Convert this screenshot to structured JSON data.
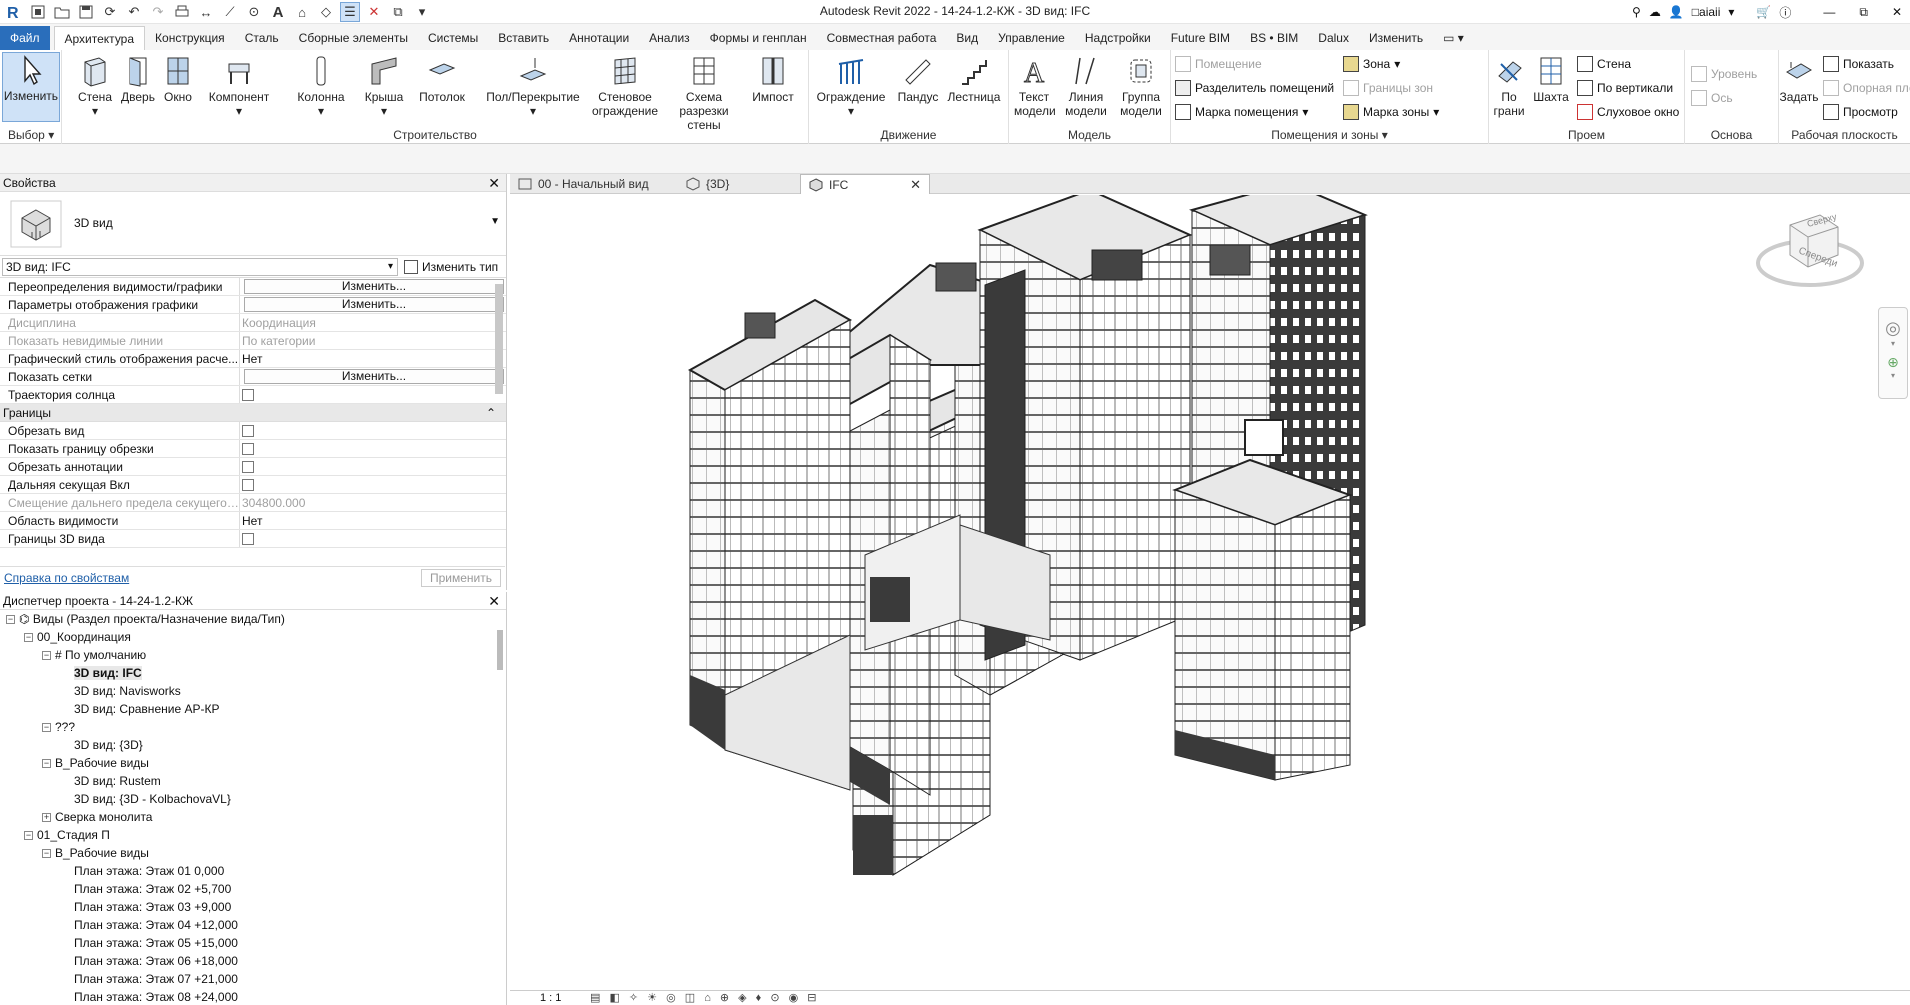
{
  "titlebar": {
    "title": "Autodesk Revit 2022 - 14-24-1.2-КЖ - 3D вид: IFC",
    "user": "□aiaii"
  },
  "ribbon_tabs": [
    "Файл",
    "Архитектура",
    "Конструкция",
    "Сталь",
    "Сборные элементы",
    "Системы",
    "Вставить",
    "Аннотации",
    "Анализ",
    "Формы и генплан",
    "Совместная работа",
    "Вид",
    "Управление",
    "Надстройки",
    "Future BIM",
    "BS • BIM",
    "Dalux",
    "Изменить"
  ],
  "ribbon": {
    "select": {
      "modify": "Изменить",
      "label": "Выбор"
    },
    "build": {
      "wall": "Стена",
      "door": "Дверь",
      "window": "Окно",
      "component": "Компонент",
      "column": "Колонна",
      "roof": "Крыша",
      "ceiling": "Потолок",
      "floor": "Пол/Перекрытие",
      "curtain_system": "Стеновое ограждение",
      "curtain_grid": "Схема разрезки стены",
      "mullion": "Импост",
      "label": "Строительство"
    },
    "circulation": {
      "railing": "Ограждение",
      "ramp": "Пандус",
      "stair": "Лестница",
      "label": "Движение"
    },
    "model": {
      "text": "Текст модели",
      "line": "Линия модели",
      "group": "Группа модели",
      "label": "Модель"
    },
    "rooms": {
      "room": "Помещение",
      "separator": "Разделитель помещений",
      "tag_room": "Марка помещения",
      "area": "Зона",
      "area_boundary": "Границы зон",
      "tag_area": "Марка зоны",
      "label": "Помещения и зоны"
    },
    "opening": {
      "by_face": "По грани",
      "shaft": "Шахта",
      "wall": "Стена",
      "vertical": "По вертикали",
      "dormer": "Слуховое окно",
      "label": "Проем"
    },
    "datum": {
      "level": "Уровень",
      "grid": "Ось",
      "label": "Основа"
    },
    "workplane": {
      "set": "Задать",
      "show": "Показать",
      "ref_plane": "Опорная плоскость",
      "viewer": "Просмотр",
      "label": "Рабочая плоскость"
    }
  },
  "properties": {
    "title": "Свойства",
    "type_name": "3D вид",
    "instance": "3D вид: IFC",
    "edit_type": "Изменить тип",
    "rows_top": [
      {
        "k": "Переопределения видимости/графики",
        "v": "Изменить...",
        "btn": true
      },
      {
        "k": "Параметры отображения графики",
        "v": "Изменить...",
        "btn": true
      },
      {
        "k": "Дисциплина",
        "v": "Координация",
        "dim": true
      },
      {
        "k": "Показать невидимые линии",
        "v": "По категории",
        "dim": true
      },
      {
        "k": "Графический стиль отображения расче...",
        "v": "Нет"
      },
      {
        "k": "Показать сетки",
        "v": "Изменить...",
        "btn": true
      },
      {
        "k": "Траектория солнца",
        "v": "",
        "chk": true
      }
    ],
    "group": "Границы",
    "rows_bottom": [
      {
        "k": "Обрезать вид",
        "v": "",
        "chk": true
      },
      {
        "k": "Показать границу обрезки",
        "v": "",
        "chk": true
      },
      {
        "k": "Обрезать аннотации",
        "v": "",
        "chk": true
      },
      {
        "k": "Дальняя секущая Вкл",
        "v": "",
        "chk": true
      },
      {
        "k": "Смещение дальнего предела секущего ...",
        "v": "304800.000",
        "dim": true
      },
      {
        "k": "Область видимости",
        "v": "Нет"
      },
      {
        "k": "Границы 3D вида",
        "v": "",
        "chk": true
      }
    ],
    "help": "Справка по свойствам",
    "apply": "Применить"
  },
  "browser": {
    "title": "Диспетчер проекта - 14-24-1.2-КЖ",
    "nodes": [
      {
        "t": "Виды (Раздел проекта/Назначение вида/Тип)",
        "lvl": 0,
        "tog": "−"
      },
      {
        "t": "00_Координация",
        "lvl": 1,
        "tog": "−"
      },
      {
        "t": "# По умолчанию",
        "lvl": 2,
        "tog": "−"
      },
      {
        "t": "3D вид: IFC",
        "lvl": 3,
        "bold": true
      },
      {
        "t": "3D вид: Navisworks",
        "lvl": 3
      },
      {
        "t": "3D вид: Сравнение АР-КР",
        "lvl": 3
      },
      {
        "t": "???",
        "lvl": 2,
        "tog": "−"
      },
      {
        "t": "3D вид: {3D}",
        "lvl": 3
      },
      {
        "t": "В_Рабочие виды",
        "lvl": 2,
        "tog": "−"
      },
      {
        "t": "3D вид: Rustem",
        "lvl": 3
      },
      {
        "t": "3D вид: {3D - KolbachovaVL}",
        "lvl": 3
      },
      {
        "t": "Сверка монолита",
        "lvl": 2,
        "tog": "+"
      },
      {
        "t": "01_Стадия П",
        "lvl": 1,
        "tog": "−"
      },
      {
        "t": "В_Рабочие виды",
        "lvl": 2,
        "tog": "−"
      },
      {
        "t": "План этажа: Этаж 01 0,000",
        "lvl": 3
      },
      {
        "t": "План этажа: Этаж 02 +5,700",
        "lvl": 3
      },
      {
        "t": "План этажа: Этаж 03 +9,000",
        "lvl": 3
      },
      {
        "t": "План этажа: Этаж 04 +12,000",
        "lvl": 3
      },
      {
        "t": "План этажа: Этаж 05 +15,000",
        "lvl": 3
      },
      {
        "t": "План этажа: Этаж 06 +18,000",
        "lvl": 3
      },
      {
        "t": "План этажа: Этаж 07 +21,000",
        "lvl": 3
      },
      {
        "t": "План этажа: Этаж 08 +24,000",
        "lvl": 3
      }
    ]
  },
  "viewtabs": [
    "00 - Начальный вид",
    "{3D}",
    "IFC"
  ],
  "viewcube": {
    "top": "Сверху",
    "front": "Спереди"
  },
  "status": {
    "scale": "1 : 1"
  }
}
